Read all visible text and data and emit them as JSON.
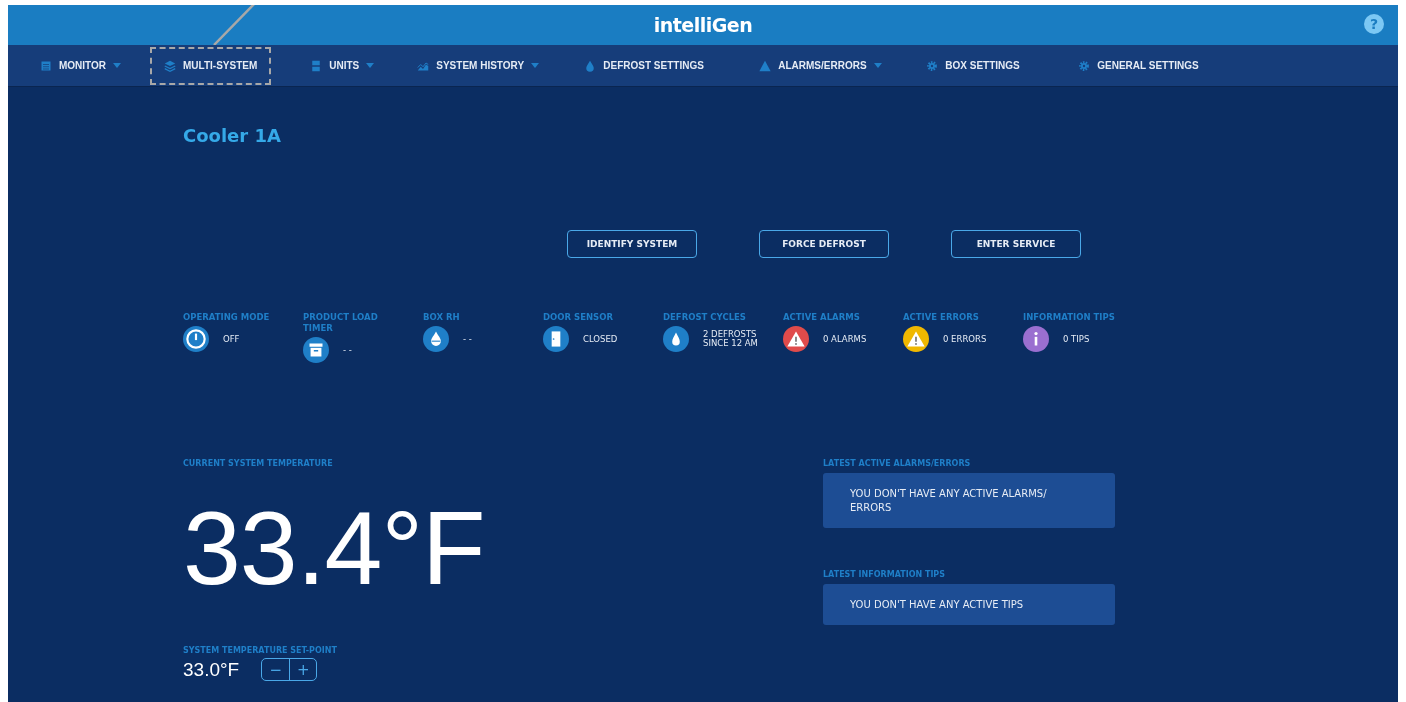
{
  "header": {
    "logo": "intelliGen",
    "help": "?"
  },
  "nav": [
    {
      "label": "MONITOR",
      "kind": "calendar",
      "dropdown": true,
      "highlighted": false
    },
    {
      "label": "MULTI-SYSTEM",
      "kind": "layers",
      "dropdown": false,
      "highlighted": true
    },
    {
      "label": "UNITS",
      "kind": "units",
      "dropdown": true,
      "highlighted": false
    },
    {
      "label": "SYSTEM HISTORY",
      "kind": "chart",
      "dropdown": true,
      "highlighted": false
    },
    {
      "label": "DEFROST SETTINGS",
      "kind": "drop",
      "dropdown": false,
      "highlighted": false
    },
    {
      "label": "ALARMS/ERRORS",
      "kind": "warning",
      "dropdown": true,
      "highlighted": false
    },
    {
      "label": "BOX SETTINGS",
      "kind": "gear",
      "dropdown": false,
      "highlighted": false
    },
    {
      "label": "GENERAL SETTINGS",
      "kind": "gear",
      "dropdown": false,
      "highlighted": false
    }
  ],
  "title": "Cooler 1A",
  "actions": [
    "IDENTIFY SYSTEM",
    "FORCE DEFROST",
    "ENTER SERVICE"
  ],
  "stats": [
    {
      "label": "OPERATING MODE",
      "value": "OFF",
      "kind": "power",
      "color": "#1f7fc8"
    },
    {
      "label": "PRODUCT LOAD TIMER",
      "value": "- -",
      "kind": "box",
      "color": "#1f7fc8"
    },
    {
      "label": "BOX RH",
      "value": "- -",
      "kind": "humidity",
      "color": "#1f7fc8"
    },
    {
      "label": "DOOR SENSOR",
      "value": "CLOSED",
      "kind": "door",
      "color": "#1f7fc8"
    },
    {
      "label": "DEFROST CYCLES",
      "value": "2 DEFROSTS SINCE 12 AM",
      "kind": "drop",
      "color": "#1f7fc8"
    },
    {
      "label": "ACTIVE ALARMS",
      "value": "0 ALARMS",
      "kind": "warning",
      "color": "#e04b4b"
    },
    {
      "label": "ACTIVE ERRORS",
      "value": "0 ERRORS",
      "kind": "warning",
      "color": "#f0b800"
    },
    {
      "label": "INFORMATION TIPS",
      "value": "0 TIPS",
      "kind": "info",
      "color": "#9a6fd0"
    }
  ],
  "temperature": {
    "label": "CURRENT SYSTEM TEMPERATURE",
    "value": "33.4°F"
  },
  "setpoint": {
    "label": "SYSTEM TEMPERATURE SET-POINT",
    "value": "33.0°F",
    "decrease": "−",
    "increase": "+"
  },
  "panels": [
    {
      "label": "LATEST ACTIVE ALARMS/ERRORS",
      "message": "YOU DON'T HAVE ANY ACTIVE ALARMS/ ERRORS"
    },
    {
      "label": "LATEST INFORMATION TIPS",
      "message": "YOU DON'T HAVE ANY ACTIVE TIPS"
    }
  ]
}
